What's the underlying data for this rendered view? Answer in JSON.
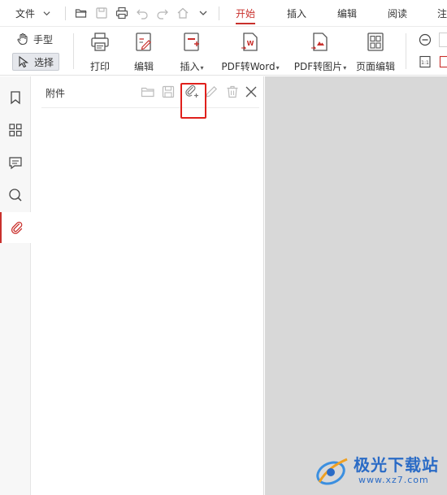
{
  "menubar": {
    "file_label": "文件",
    "tabs": [
      {
        "label": "开始",
        "active": true
      },
      {
        "label": "插入",
        "active": false
      },
      {
        "label": "编辑",
        "active": false
      },
      {
        "label": "阅读",
        "active": false
      },
      {
        "label": "注",
        "active": false
      }
    ],
    "quick_access_icons": [
      "open-folder-icon",
      "save-icon",
      "print-icon",
      "undo-icon",
      "redo-icon",
      "home-icon",
      "chevron-down-icon"
    ]
  },
  "ribbon": {
    "hand_tool_label": "手型",
    "select_tool_label": "选择",
    "tools": [
      {
        "label": "打印",
        "icon": "printer-icon",
        "dropdown": false
      },
      {
        "label": "编辑",
        "icon": "edit-document-icon",
        "dropdown": false
      },
      {
        "label": "插入",
        "icon": "insert-page-icon",
        "dropdown": true
      },
      {
        "label": "PDF转Word",
        "icon": "pdf-to-word-icon",
        "dropdown": true
      },
      {
        "label": "PDF转图片",
        "icon": "pdf-to-image-icon",
        "dropdown": true
      },
      {
        "label": "页面编辑",
        "icon": "page-grid-icon",
        "dropdown": false
      }
    ],
    "dropdown_marker": "▾"
  },
  "rail": {
    "items": [
      {
        "icon": "bookmark-icon",
        "active": false
      },
      {
        "icon": "thumbnails-icon",
        "active": false
      },
      {
        "icon": "comment-icon",
        "active": false
      },
      {
        "icon": "search-icon",
        "active": false
      },
      {
        "icon": "attachment-icon",
        "active": true
      }
    ]
  },
  "panel": {
    "title": "附件",
    "toolbar_icons": [
      "open-folder-icon",
      "save-icon",
      "add-attachment-icon",
      "edit-pencil-icon",
      "delete-trash-icon",
      "close-icon"
    ],
    "highlighted_tool": "add-attachment-icon"
  },
  "watermark": {
    "title": "极光下载站",
    "url": "www.xz7.com"
  },
  "colors": {
    "accent": "#c9302c",
    "highlight_box": "#e0201c",
    "canvas": "#d8d8d8",
    "watermark": "#2a6bc6"
  }
}
